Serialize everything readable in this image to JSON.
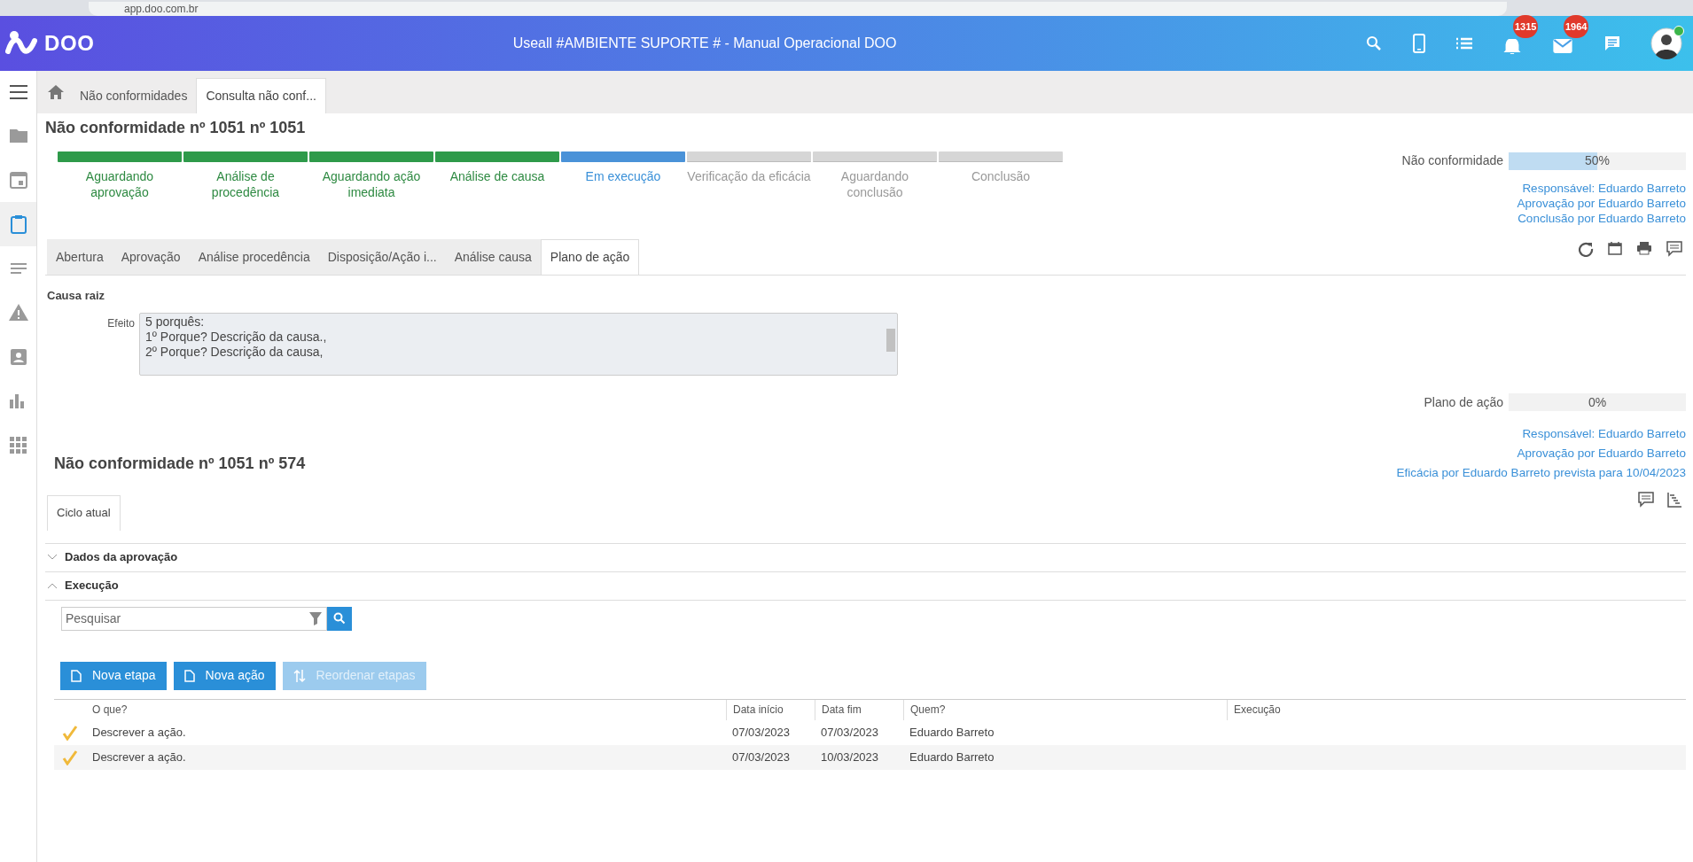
{
  "browser": {
    "url": "app.doo.com.br"
  },
  "header": {
    "logo": "DOO",
    "title": "Useall #AMBIENTE SUPORTE # - Manual Operacional DOO",
    "notifications": "1315",
    "messages": "1964"
  },
  "sidebar": {
    "items": [
      {
        "kind": "folder",
        "selected": false
      },
      {
        "kind": "calendar",
        "selected": false
      },
      {
        "kind": "clipboard",
        "selected": true
      },
      {
        "kind": "lines",
        "selected": false
      },
      {
        "kind": "warning",
        "selected": false
      },
      {
        "kind": "contact",
        "selected": false
      },
      {
        "kind": "chart",
        "selected": false
      },
      {
        "kind": "grid",
        "selected": false
      }
    ]
  },
  "breadcrumbs": [
    {
      "label": "Não conformidades",
      "selected": false
    },
    {
      "label": "Consulta não conf...",
      "selected": true
    }
  ],
  "title": "Não conformidade nº 1051 nº 1051",
  "steps": [
    {
      "label": "Aguardando aprovação",
      "kind": "done"
    },
    {
      "label": "Análise de procedência",
      "kind": "done"
    },
    {
      "label": "Aguardando ação imediata",
      "kind": "done"
    },
    {
      "label": "Análise de causa",
      "kind": "done"
    },
    {
      "label": "Em execução",
      "kind": "current"
    },
    {
      "label": "Verificação da eficácia",
      "kind": "pending"
    },
    {
      "label": "Aguardando conclusão",
      "kind": "pending"
    },
    {
      "label": "Conclusão",
      "kind": "pending"
    }
  ],
  "progress": {
    "label": "Não conformidade",
    "level": 0.5,
    "reading": "50%"
  },
  "info_links": [
    "Responsável: Eduardo Barreto",
    "Aprovação por Eduardo Barreto",
    "Conclusão por Eduardo Barreto"
  ],
  "tabs": [
    {
      "label": "Abertura",
      "selected": false
    },
    {
      "label": "Aprovação",
      "selected": false
    },
    {
      "label": "Análise procedência",
      "selected": false
    },
    {
      "label": "Disposição/Ação i...",
      "selected": false
    },
    {
      "label": "Análise causa",
      "selected": false
    },
    {
      "label": "Plano de ação",
      "selected": true
    }
  ],
  "section": {
    "title": "Causa raiz",
    "field_label": "Efeito",
    "lines": [
      "5 porquês:",
      "1º Porque? Descrição da causa.,",
      "2º Porque? Descrição da causa,"
    ]
  },
  "plan_progress": {
    "label": "Plano de ação",
    "level": 0,
    "reading": "0%"
  },
  "plan_links": [
    "Responsável: Eduardo Barreto",
    "Aprovação por Eduardo Barreto",
    "Eficácia por Eduardo Barreto prevista para 10/04/2023"
  ],
  "sub_title": "Não conformidade nº 1051 nº 574",
  "sub_tabs": [
    {
      "label": "Ciclo atual",
      "selected": true
    }
  ],
  "panels": [
    {
      "title": "Dados da aprovação",
      "expanded": false
    },
    {
      "title": "Execução",
      "expanded": true
    }
  ],
  "search": {
    "placeholder": "Pesquisar"
  },
  "buttons": [
    {
      "label": "Nova etapa",
      "disabled": false,
      "kind": "doc"
    },
    {
      "label": "Nova ação",
      "disabled": false,
      "kind": "doc"
    },
    {
      "label": "Reordenar etapas",
      "disabled": true,
      "kind": "sort"
    }
  ],
  "table": {
    "columns": [
      "O que?",
      "Data início",
      "Data fim",
      "Quem?",
      "Execução"
    ],
    "rows": [
      {
        "done": true,
        "cells": [
          "Descrever a ação.",
          "07/03/2023",
          "07/03/2023",
          "Eduardo Barreto",
          ""
        ]
      },
      {
        "done": true,
        "cells": [
          "Descrever a ação.",
          "07/03/2023",
          "10/03/2023",
          "Eduardo Barreto",
          ""
        ]
      }
    ]
  }
}
